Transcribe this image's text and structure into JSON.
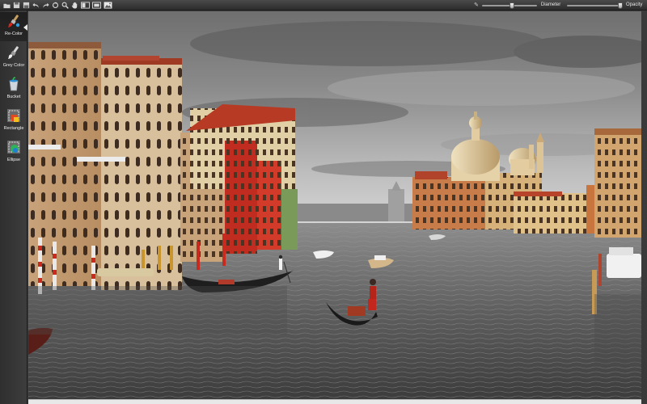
{
  "toolbar": {
    "icons": [
      "open-icon",
      "save-icon",
      "save-as-icon",
      "undo-icon",
      "redo-icon",
      "reset-icon",
      "zoom-icon",
      "hand-icon",
      "compare-icon",
      "fit-icon",
      "export-image-icon"
    ],
    "diameter_label": "Diameter",
    "diameter_value": 0.55,
    "opacity_label": "Opacity",
    "opacity_value": 0.97
  },
  "palette": {
    "active_tool": "recolor",
    "tools": [
      {
        "id": "recolor",
        "label": "Re-Color",
        "icon": "recolor-brush-icon"
      },
      {
        "id": "greycolor",
        "label": "Grey Color",
        "icon": "grey-brush-icon"
      },
      {
        "id": "bucket",
        "label": "Bucket",
        "icon": "bucket-icon"
      },
      {
        "id": "rectangle",
        "label": "Rectangle",
        "icon": "rectangle-icon"
      },
      {
        "id": "ellipse",
        "label": "Ellipse",
        "icon": "ellipse-icon"
      }
    ]
  },
  "canvas": {
    "image": "venice-grand-canal-photo"
  },
  "colors": {
    "toolbar_bg": "#3a3a3a",
    "palette_bg": "#353535",
    "accent_red": "#c0251a",
    "warm_facade": "#d9b37a"
  }
}
